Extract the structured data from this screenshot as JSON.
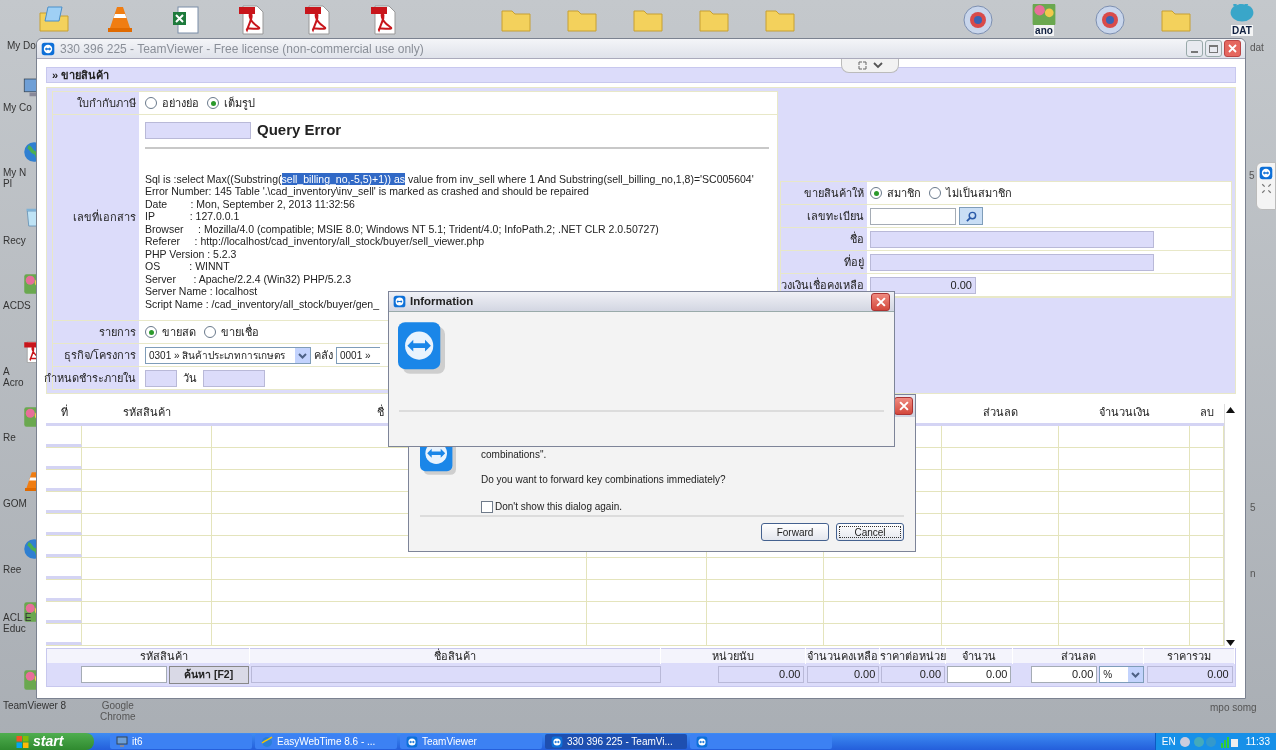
{
  "desktop": {
    "top_icons": [
      {
        "kind": "folder-doc",
        "label": "My Do"
      },
      {
        "kind": "cone"
      },
      {
        "kind": "spreadsheet"
      },
      {
        "kind": "pdf"
      },
      {
        "kind": "pdf"
      },
      {
        "kind": "pdf"
      },
      {
        "kind": "folder"
      },
      {
        "kind": "folder"
      },
      {
        "kind": "folder"
      },
      {
        "kind": "folder"
      },
      {
        "kind": "folder"
      },
      {
        "kind": "emblem"
      },
      {
        "kind": "app",
        "badge": "ano"
      },
      {
        "kind": "emblem"
      },
      {
        "kind": "folder"
      },
      {
        "kind": "dat",
        "badge": "DAT"
      }
    ],
    "left_icons": [
      {
        "kind": "computer",
        "lines": [
          "My Co"
        ]
      },
      {
        "kind": "globe",
        "lines": [
          "My N",
          "Pl"
        ]
      },
      {
        "kind": "bin",
        "lines": [
          "Recy"
        ]
      },
      {
        "kind": "app",
        "lines": [
          "ACDS"
        ]
      },
      {
        "kind": "pdf",
        "lines": [
          "A",
          "Acro"
        ]
      },
      {
        "kind": "app",
        "lines": [
          "Re"
        ]
      },
      {
        "kind": "cone",
        "lines": [
          "GOM"
        ]
      },
      {
        "kind": "globe",
        "lines": [
          "Ree"
        ]
      },
      {
        "kind": "app",
        "lines": [
          "ACL E",
          "Educ"
        ]
      },
      {
        "kind": "app",
        "lines": [
          "TeamViewer 8"
        ]
      }
    ],
    "bottom_labels": [
      "Google",
      "Chrome"
    ],
    "right_labels": [
      "dat",
      "5",
      "5",
      "n",
      "mpo somg"
    ]
  },
  "window": {
    "title": "330 396 225 - TeamViewer - Free license (non-commercial use only)"
  },
  "form": {
    "header": "» ขายสินค้า",
    "tax_invoice": {
      "label": "ใบกำกับภาษี",
      "options": [
        {
          "label": "อย่างย่อ",
          "selected": false
        },
        {
          "label": "เต็มรูป",
          "selected": true
        }
      ]
    },
    "document_no": {
      "label": "เลขที่เอกสาร",
      "error_title": "Query Error",
      "sql_before": "Sql is :select Max((Substring(",
      "sql_highlight": "sell_billing_no,-5,5)+1)) as",
      "sql_after": " value from inv_sell where 1 And Substring(sell_billing_no,1,8)='SC005604'",
      "lines": [
        "Error Number: 145 Table '.\\cad_inventory\\inv_sell' is marked as crashed and should be repaired",
        "Date        : Mon, September 2, 2013 11:32:56",
        "IP            : 127.0.0.1",
        "Browser     : Mozilla/4.0 (compatible; MSIE 8.0; Windows NT 5.1; Trident/4.0; InfoPath.2; .NET CLR 2.0.50727)",
        "Referer     : http://localhost/cad_inventory/all_stock/buyer/sell_viewer.php",
        "PHP Version : 5.2.3",
        "OS          : WINNT",
        "Server      : Apache/2.2.4 (Win32) PHP/5.2.3",
        "Server Name : localhost",
        "Script Name : /cad_inventory/all_stock/buyer/gen_"
      ]
    },
    "sale_type": {
      "label": "รายการ",
      "options": [
        {
          "label": "ขายสด",
          "selected": true
        },
        {
          "label": "ขายเชื่อ",
          "selected": false
        }
      ]
    },
    "business": {
      "label": "ธุรกิจ/โครงการ",
      "value": "0301 » สินค้าประเภทการเกษตร",
      "warehouse_label": "คลัง",
      "warehouse_value": "0001 »"
    },
    "due": {
      "label": "กำหนดชำระภายใน",
      "unit": "วัน"
    },
    "sell_to": {
      "label": "ขายสินค้าให้",
      "options": [
        {
          "label": "สมาชิก",
          "selected": true
        },
        {
          "label": "ไม่เป็นสมาชิก",
          "selected": false
        }
      ]
    },
    "registration": {
      "label": "เลขทะเบียน"
    },
    "name": {
      "label": "ชื่อ"
    },
    "address": {
      "label": "ที่อยู่"
    },
    "credit": {
      "label": "วงเงินเชื่อคงเหลือ",
      "value": "0.00"
    }
  },
  "table": {
    "columns": [
      "ที่",
      "รหัสสินค้า",
      "ชื่",
      null,
      null,
      null,
      "ส่วนลด",
      "จำนวนเงิน",
      "ลบ"
    ]
  },
  "entry": {
    "labels": [
      "รหัสสินค้า",
      "ชื่อสินค้า",
      "หน่วยนับ",
      "จำนวนคงเหลือ",
      "ราคาต่อหน่วย",
      "จำนวน",
      "ส่วนลด",
      "ราคารวม"
    ],
    "search_button": "ค้นหา [F2]",
    "unit": "0.00",
    "remaining": "0.00",
    "price": "0.00",
    "quantity": "0.00",
    "discount": "0.00",
    "discount_unit": "%",
    "total": "0.00"
  },
  "info_dialog": {
    "title": "Information"
  },
  "forward_dialog": {
    "text_1": "combinations\".",
    "text_2": "Do you want to forward key combinations immediately?",
    "checkbox": {
      "label": "Don't show this dialog again.",
      "checked": false
    },
    "buttons": [
      "Forward",
      "Cancel"
    ]
  },
  "taskbar": {
    "start": "start",
    "tasks": [
      {
        "kind": "computer",
        "label": "it6",
        "selected": false
      },
      {
        "kind": "browser",
        "label": "EasyWebTime 8.6 - ...",
        "selected": false
      },
      {
        "kind": "teamviewer",
        "label": "TeamViewer",
        "selected": false
      },
      {
        "kind": "teamviewer",
        "label": "330 396 225 - TeamVi...",
        "selected": true
      }
    ],
    "language": "EN",
    "clock": "11:33"
  }
}
